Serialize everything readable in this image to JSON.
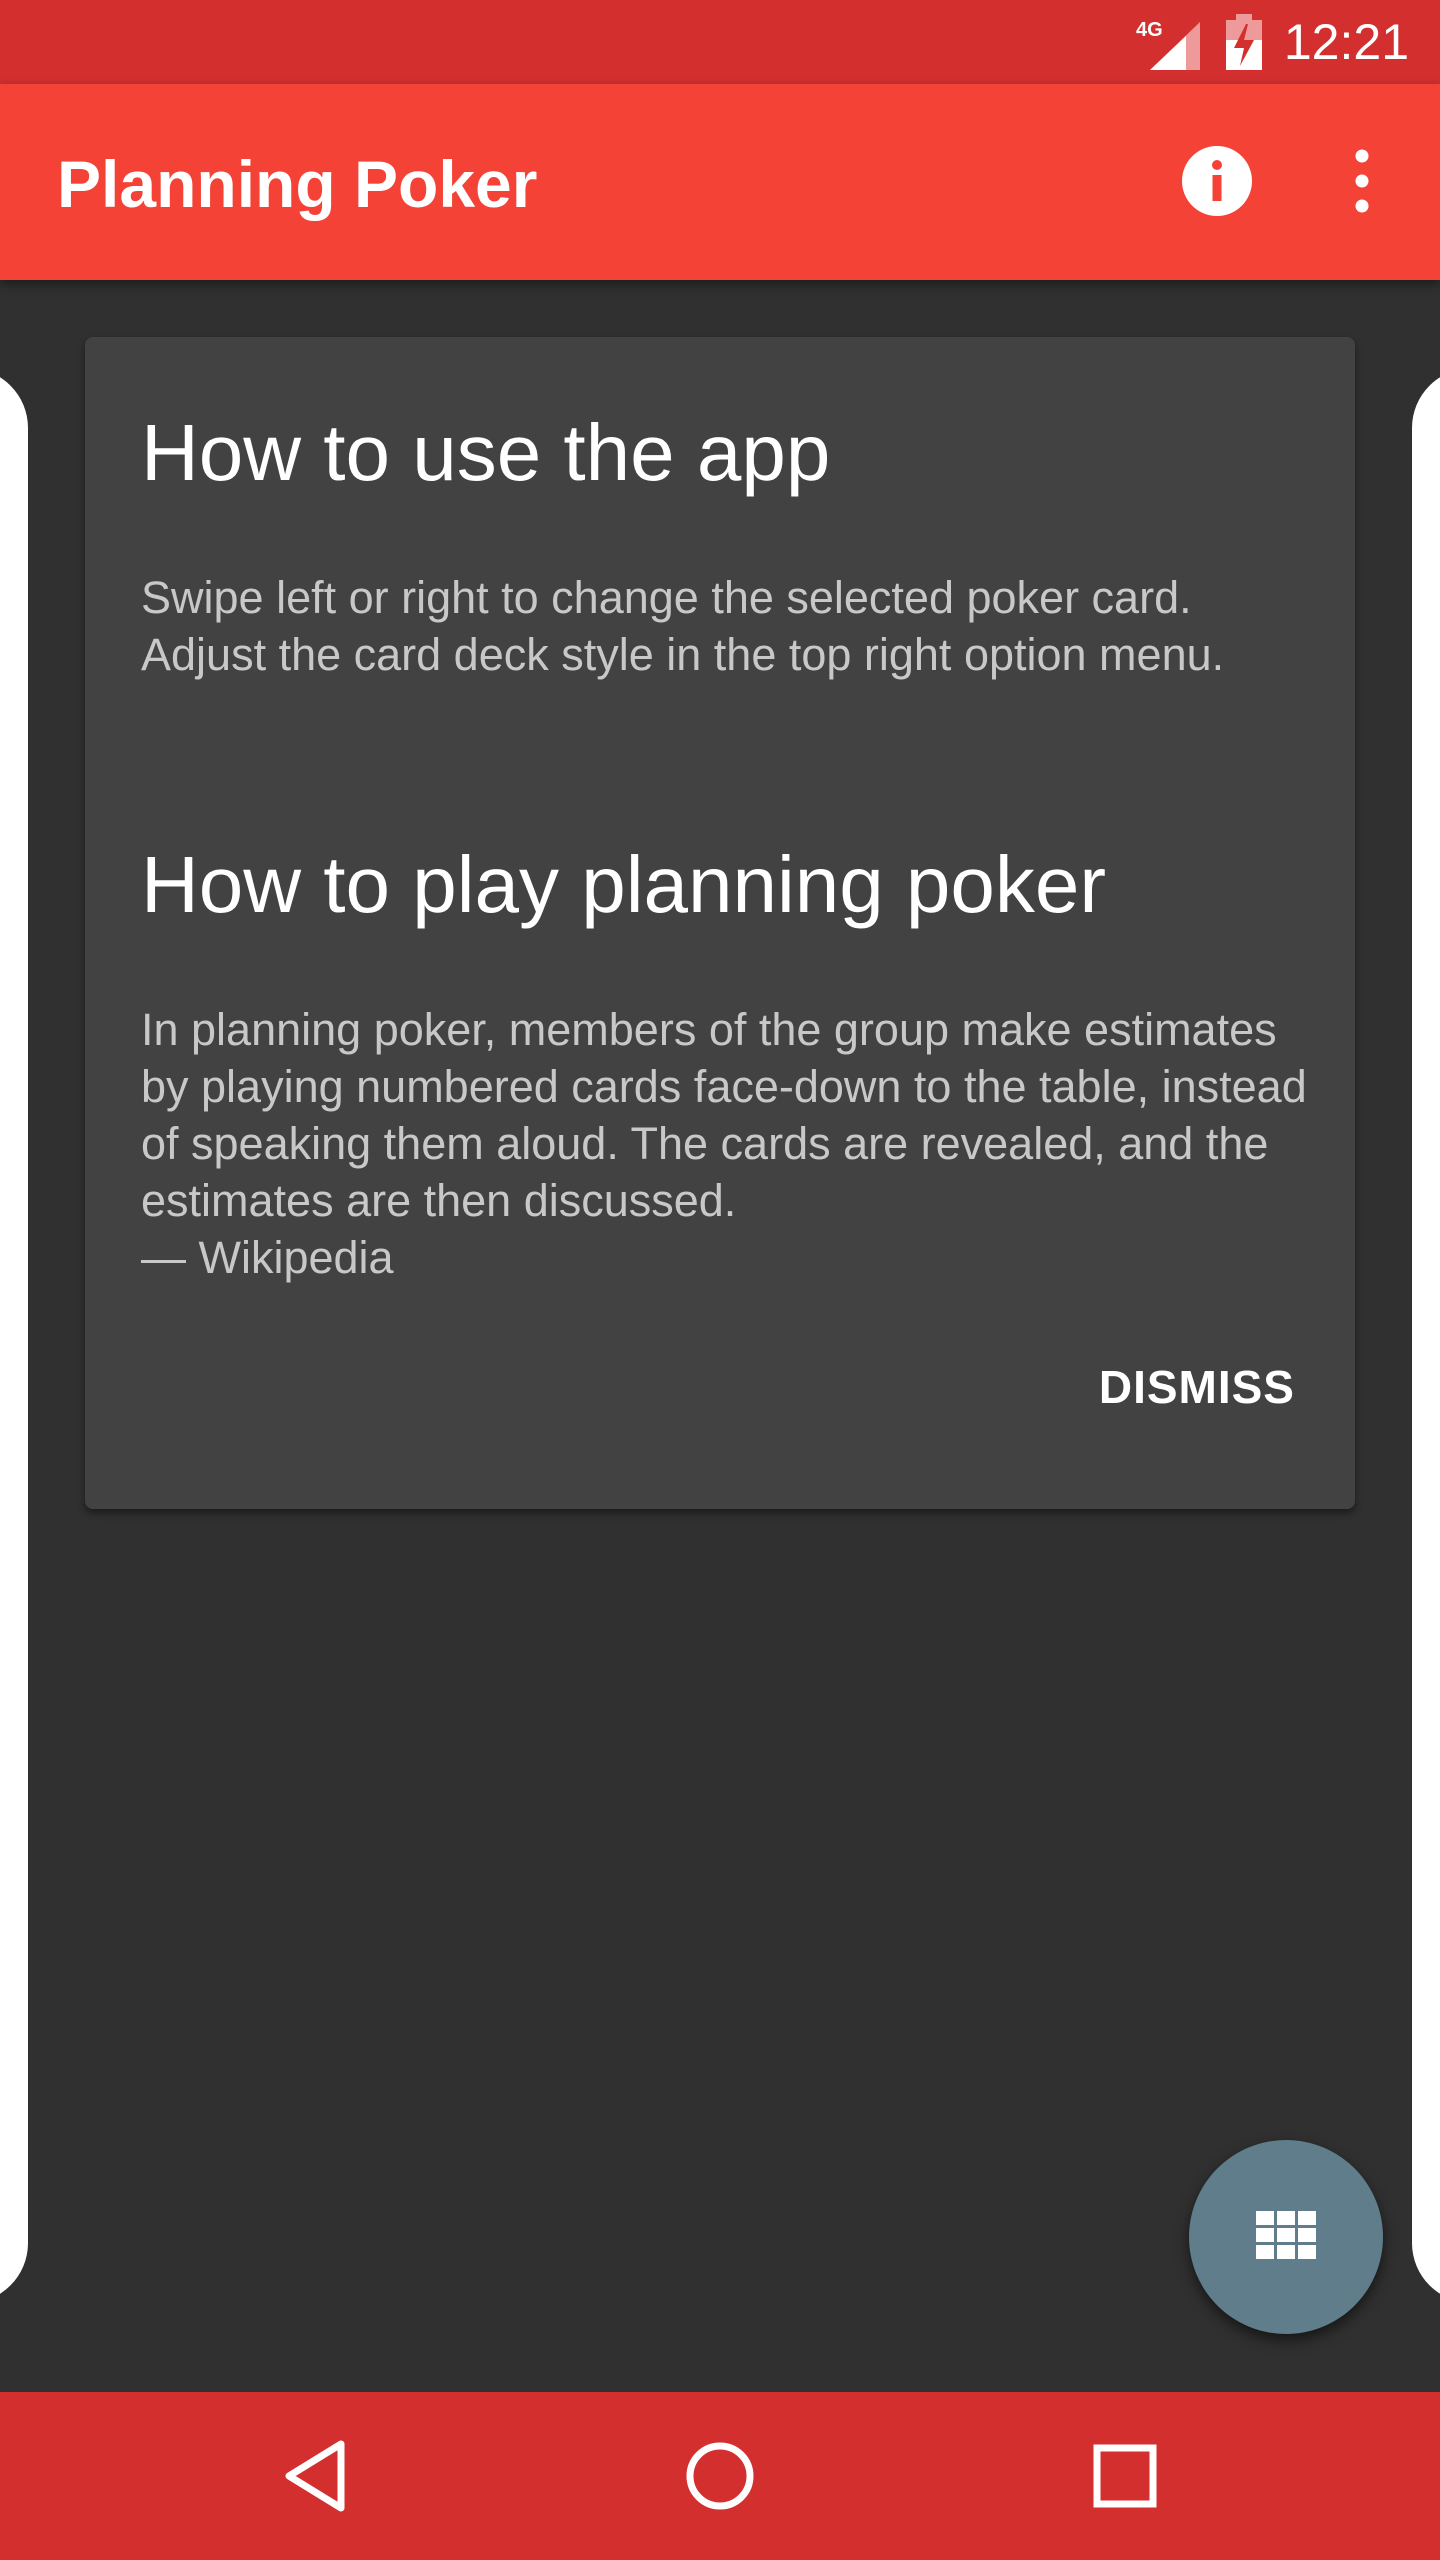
{
  "status_bar": {
    "network": "4G",
    "time": "12:21"
  },
  "app_bar": {
    "title": "Planning Poker",
    "info_icon": "info-icon",
    "menu_icon": "more-vert-icon"
  },
  "help_card": {
    "sections": [
      {
        "heading": "How to use the app",
        "body": "Swipe left or right to change the selected poker card. Adjust the card deck style in the top right option menu."
      },
      {
        "heading": "How to play planning poker",
        "body": "In planning poker, members of the group make estimates by playing numbered cards face-down to the table, instead of speaking them aloud. The cards are revealed, and the estimates are then discussed.",
        "attribution": "— Wikipedia"
      }
    ],
    "dismiss_label": "DISMISS"
  },
  "fab": {
    "icon": "grid-icon"
  },
  "nav_bar": {
    "back_icon": "back-icon",
    "home_icon": "home-icon",
    "recents_icon": "recents-icon"
  },
  "colors": {
    "status_bar": "#d32f2f",
    "app_bar": "#f44336",
    "background": "#303030",
    "card": "#424242",
    "fab": "#607d8b",
    "nav_bar": "#d32f2f"
  }
}
